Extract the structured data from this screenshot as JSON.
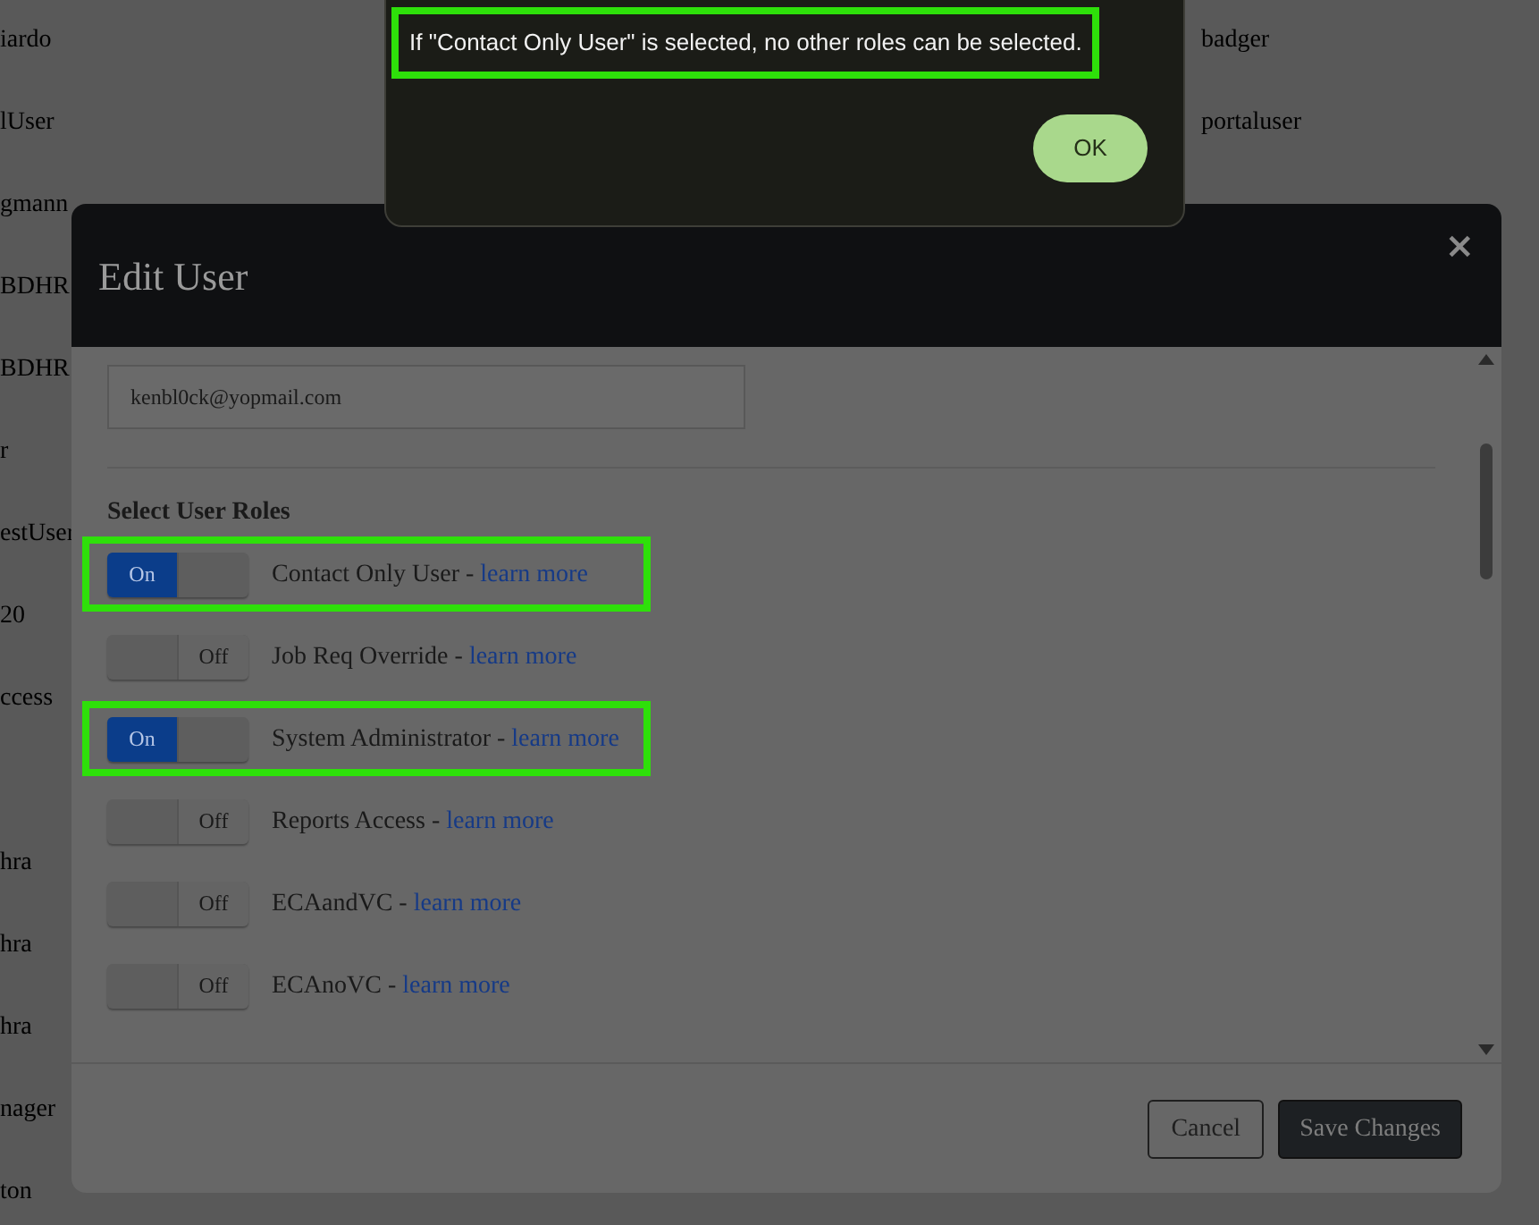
{
  "background_list": {
    "left_column": [
      {
        "text": "iardo"
      },
      {
        "text": "lUser"
      },
      {
        "text": "gmann"
      },
      {
        "text": "BDHR"
      },
      {
        "text": "BDHR"
      },
      {
        "text": "r"
      },
      {
        "text": "estUser"
      },
      {
        "text": "20"
      },
      {
        "text": "ccess"
      },
      {
        "text": "hra",
        "gap_before": true
      },
      {
        "text": "hra"
      },
      {
        "text": "hra"
      },
      {
        "text": "nager"
      },
      {
        "text": "ton"
      }
    ],
    "right_column": [
      "badger",
      "portaluser"
    ]
  },
  "alert": {
    "message": "If \"Contact Only User\" is selected, no other roles can be selected.",
    "highlighted": true,
    "button": "OK"
  },
  "modal": {
    "title": "Edit User",
    "close": "×",
    "email_field": {
      "value": "kenbl0ck@yopmail.com"
    },
    "section_title": "Select User Roles",
    "roles": [
      {
        "name": "Contact Only User",
        "separator": "-",
        "link": "learn more",
        "on": true,
        "toggle_text": "On",
        "highlighted": true
      },
      {
        "name": "Job Req Override",
        "separator": "-",
        "link": "learn more",
        "on": false,
        "toggle_text": "Off",
        "highlighted": false
      },
      {
        "name": "System Administrator",
        "separator": "-",
        "link": "learn more",
        "on": true,
        "toggle_text": "On",
        "highlighted": true
      },
      {
        "name": "Reports Access",
        "separator": "-",
        "link": "learn more",
        "on": false,
        "toggle_text": "Off",
        "highlighted": false
      },
      {
        "name": "ECAandVC",
        "separator": "-",
        "link": "learn more",
        "on": false,
        "toggle_text": "Off",
        "highlighted": false
      },
      {
        "name": "ECAnoVC",
        "separator": "-",
        "link": "learn more",
        "on": false,
        "toggle_text": "Off",
        "highlighted": false
      }
    ],
    "buttons": {
      "cancel": "Cancel",
      "save": "Save Changes"
    }
  }
}
